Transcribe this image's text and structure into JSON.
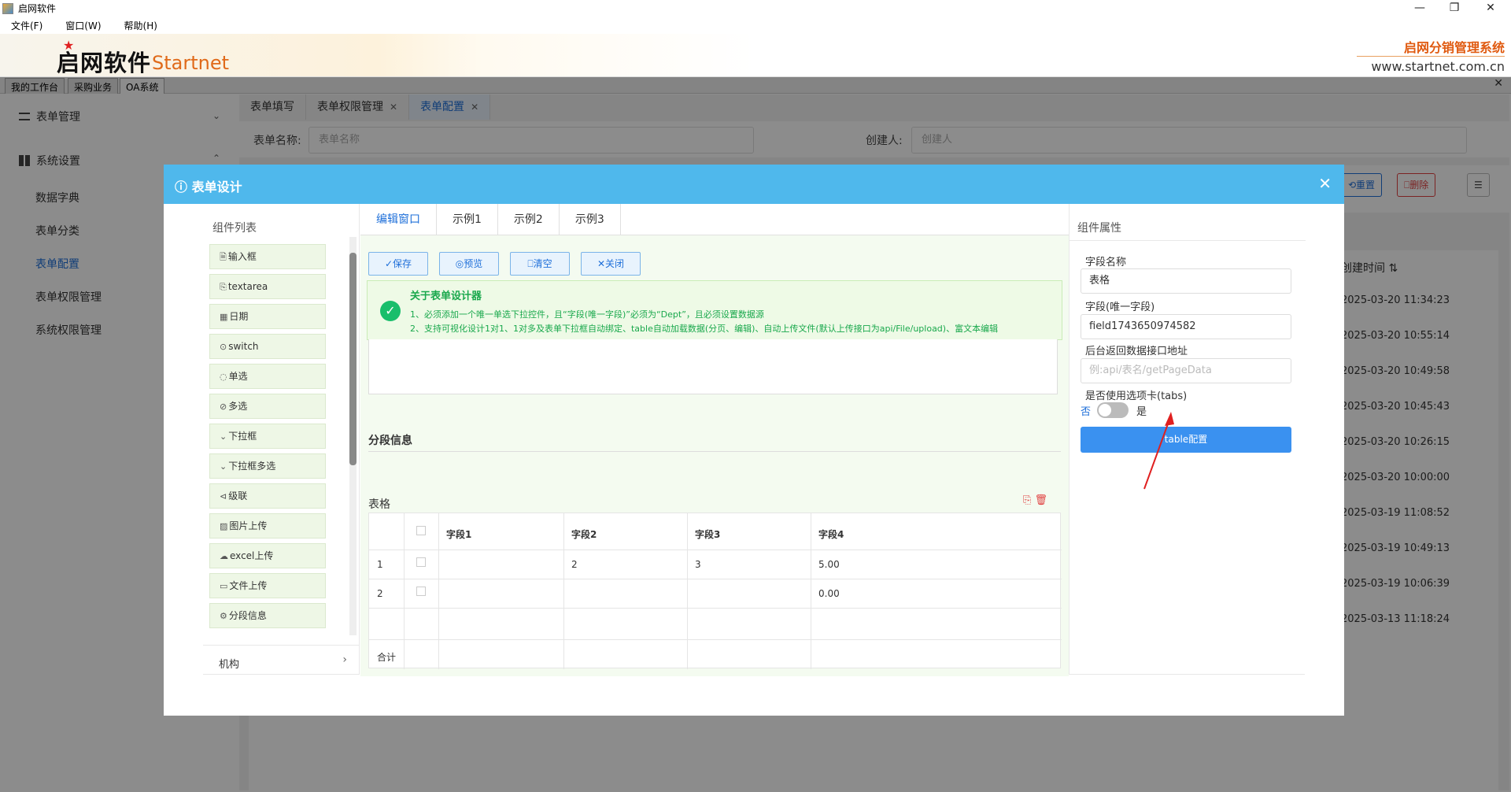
{
  "window": {
    "title": "启网软件",
    "controls": [
      "—",
      "❐",
      "✕"
    ]
  },
  "menubar": [
    "文件(F)",
    "窗口(W)",
    "帮助(H)"
  ],
  "banner": {
    "logo_cn": "启网软件",
    "logo_en": "Startnet",
    "brand_cn": "启网分销管理系统",
    "url": "www.startnet.com.cn"
  },
  "top_tabs": [
    "我的工作台",
    "采购业务",
    "OA系统"
  ],
  "top_close": "✕",
  "sidebar": {
    "groups": [
      {
        "label": "表单管理",
        "arrow": "⌄"
      },
      {
        "label": "系统设置",
        "arrow": "⌃"
      }
    ],
    "items": [
      "数据字典",
      "表单分类",
      "表单配置",
      "表单权限管理",
      "系统权限管理"
    ]
  },
  "page_tabs": [
    {
      "label": "表单填写",
      "close": ""
    },
    {
      "label": "表单权限管理",
      "close": "✕"
    },
    {
      "label": "表单配置",
      "close": "✕"
    }
  ],
  "search": {
    "name_label": "表单名称:",
    "name_placeholder": "表单名称",
    "creator_label": "创建人:",
    "creator_placeholder": "创建人"
  },
  "toolbar": {
    "reset": "⟲重置",
    "delete": "⎕删除",
    "menu": "☰"
  },
  "grid": {
    "time_header": "创建时间 ⇅",
    "times": [
      "2025-03-20 11:34:23",
      "2025-03-20 10:55:14",
      "2025-03-20 10:49:58",
      "2025-03-20 10:45:43",
      "2025-03-20 10:26:15",
      "2025-03-20 10:00:00",
      "2025-03-19 11:08:52",
      "2025-03-19 10:49:13",
      "2025-03-19 10:06:39",
      "2025-03-13 11:18:24"
    ]
  },
  "modal": {
    "title": "表单设计",
    "close": "✕",
    "components_title": "组件列表",
    "components": [
      {
        "icon": "🗎",
        "label": "输入框"
      },
      {
        "icon": "⎘",
        "label": "textarea"
      },
      {
        "icon": "▦",
        "label": "日期"
      },
      {
        "icon": "⊙",
        "label": "switch"
      },
      {
        "icon": "◌",
        "label": "单选"
      },
      {
        "icon": "⊘",
        "label": "多选"
      },
      {
        "icon": "⌄",
        "label": "下拉框"
      },
      {
        "icon": "⌄",
        "label": "下拉框多选"
      },
      {
        "icon": "⊲",
        "label": "级联"
      },
      {
        "icon": "▨",
        "label": "图片上传"
      },
      {
        "icon": "☁",
        "label": "excel上传"
      },
      {
        "icon": "▭",
        "label": "文件上传"
      },
      {
        "icon": "⚙",
        "label": "分段信息"
      }
    ],
    "org_label": "机构",
    "org_arrow": "›",
    "editor_tabs": [
      "编辑窗口",
      "示例1",
      "示例2",
      "示例3"
    ],
    "editor_buttons": [
      "✓保存",
      "◎预览",
      "⎕清空",
      "✕关闭"
    ],
    "notice": {
      "icon": "✓",
      "title": "关于表单设计器",
      "line1": "1、必须添加一个唯一单选下拉控件，且“字段(唯一字段)”必须为“Dept”，且必须设置数据源",
      "line2": "2、支持可视化设计1对1、1对多及表单下拉框自动绑定、table自动加载数据(分页、编辑)、自动上传文件(默认上传接口为api/File/upload)、富文本编辑"
    },
    "section_title": "分段信息",
    "table": {
      "title": "表格",
      "icons": [
        "⎘",
        "🗑"
      ],
      "headers": [
        "字段1",
        "字段2",
        "字段3",
        "字段4"
      ],
      "rows": [
        {
          "no": "1",
          "c1": "",
          "c2": "2",
          "c3": "3",
          "c4": "5.00"
        },
        {
          "no": "2",
          "c1": "",
          "c2": "",
          "c3": "",
          "c4": "0.00"
        }
      ],
      "total_label": "合计"
    },
    "props": {
      "title": "组件属性",
      "field_name_label": "字段名称",
      "field_name_value": "表格",
      "field_key_label": "字段(唯一字段)",
      "field_key_value": "field1743650974582",
      "api_label": "后台返回数据接口地址",
      "api_placeholder": "例:api/表名/getPageData",
      "tabs_label": "是否使用选项卡(tabs)",
      "tabs_off": "否",
      "tabs_on": "是",
      "tabs_enabled": false,
      "config_button": "table配置"
    }
  }
}
